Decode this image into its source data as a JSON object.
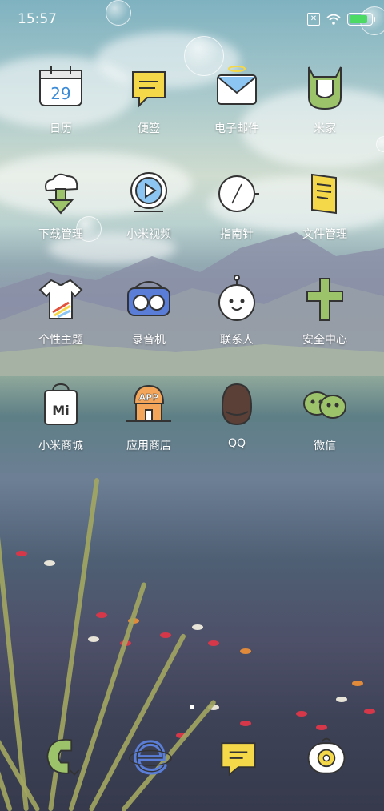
{
  "status_bar": {
    "time": "15:57"
  },
  "apps": [
    {
      "label": "日历",
      "icon": "calendar-icon",
      "badge": "29"
    },
    {
      "label": "便签",
      "icon": "notes-icon"
    },
    {
      "label": "电子邮件",
      "icon": "mail-icon"
    },
    {
      "label": "米家",
      "icon": "mijia-icon"
    },
    {
      "label": "下载管理",
      "icon": "download-icon"
    },
    {
      "label": "小米视频",
      "icon": "video-icon"
    },
    {
      "label": "指南针",
      "icon": "compass-icon"
    },
    {
      "label": "文件管理",
      "icon": "file-manager-icon"
    },
    {
      "label": "个性主题",
      "icon": "themes-icon"
    },
    {
      "label": "录音机",
      "icon": "recorder-icon"
    },
    {
      "label": "联系人",
      "icon": "contacts-icon"
    },
    {
      "label": "安全中心",
      "icon": "security-icon"
    },
    {
      "label": "小米商城",
      "icon": "mi-store-icon",
      "badge": "Mi"
    },
    {
      "label": "应用商店",
      "icon": "app-store-icon",
      "badge": "APP"
    },
    {
      "label": "QQ",
      "icon": "qq-icon"
    },
    {
      "label": "微信",
      "icon": "wechat-icon"
    }
  ],
  "dock": [
    {
      "icon": "phone-icon"
    },
    {
      "icon": "browser-icon"
    },
    {
      "icon": "messages-icon"
    },
    {
      "icon": "camera-icon"
    }
  ],
  "page_indicator": {
    "current": 1,
    "total": 1
  }
}
